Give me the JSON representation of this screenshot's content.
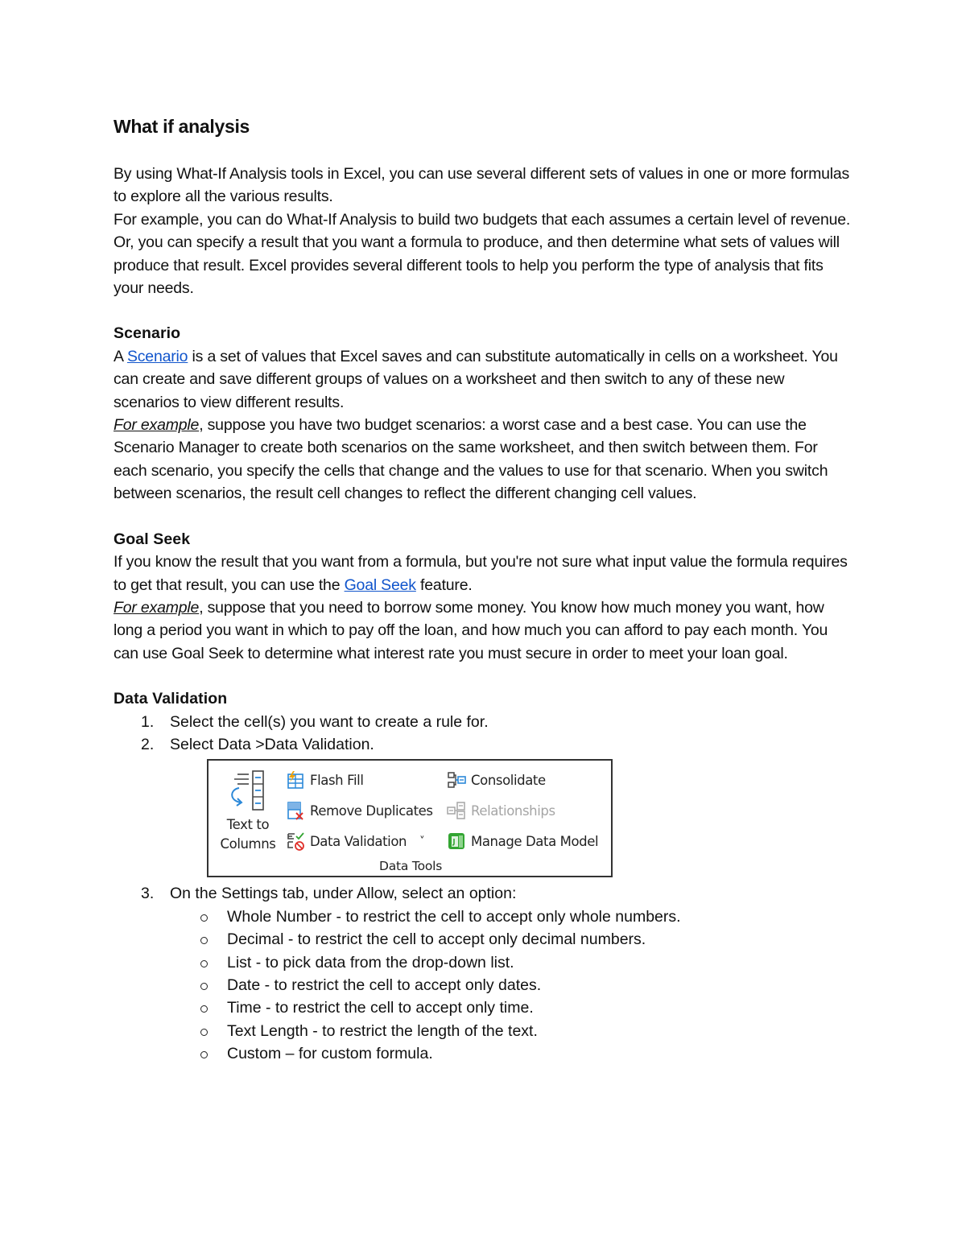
{
  "title": "What if analysis",
  "intro": {
    "p1": "By using What-If Analysis tools in Excel, you can use several different sets of values in one or more formulas to explore all the various results.",
    "p2": "For example, you can do What-If Analysis to build two budgets that each assumes a certain level of revenue. Or, you can specify a result that you want a formula to produce, and then determine what sets of values will produce that result. Excel provides several different tools to help you perform the type of analysis that fits your needs."
  },
  "scenario": {
    "heading": "Scenario",
    "pre_link": "A ",
    "link": "Scenario",
    "post_link": " is a set of values that Excel saves and can substitute automatically in cells on a worksheet. You can create and save different groups of values on a worksheet and then switch to any of these new scenarios to view different results.",
    "example_label": "For example",
    "example_text": ", suppose you have two budget scenarios: a worst case and a best case. You can use the Scenario Manager to create both scenarios on the same worksheet, and then switch between them. For each scenario, you specify the cells that change and the values to use for that scenario. When you switch between scenarios, the result cell changes to reflect the different changing cell values."
  },
  "goal_seek": {
    "heading": "Goal Seek",
    "pre_link": "If you know the result that you want from a formula, but you're not sure what input value the formula requires to get that result, you can use the ",
    "link": "Goal Seek",
    "post_link": " feature.",
    "example_label": "For example",
    "example_text": ", suppose that you need to borrow some money. You know how much money you want, how long a period you want in which to pay off the loan, and how much you can afford to pay each month. You can use Goal Seek to determine what interest rate you must secure in order to meet your loan goal."
  },
  "data_validation": {
    "heading": "Data Validation",
    "steps": [
      {
        "num": "1.",
        "text": "Select the cell(s) you want to create a rule for."
      },
      {
        "num": "2.",
        "text": "Select Data >Data Validation."
      },
      {
        "num": "3.",
        "text": "On the Settings tab, under Allow, select an option:"
      }
    ],
    "options": [
      "Whole Number - to restrict the cell to accept only whole numbers.",
      "Decimal - to restrict the cell to accept only decimal numbers.",
      "List - to pick data from the drop-down list.",
      "Date - to restrict the cell to accept only dates.",
      "Time - to restrict the cell to accept only time.",
      "Text Length - to restrict the length of the text.",
      "Custom – for custom formula."
    ]
  },
  "ribbon": {
    "text_to_columns_line1": "Text to",
    "text_to_columns_line2": "Columns",
    "flash_fill": "Flash Fill",
    "remove_duplicates": "Remove Duplicates",
    "data_validation": "Data Validation",
    "dropdown_arrow": "˅",
    "consolidate": "Consolidate",
    "relationships": "Relationships",
    "manage_data_model": "Manage Data Model",
    "group_label": "Data Tools",
    "colors": {
      "blue": "#2b88d8",
      "red": "#e0302a",
      "green": "#33a532",
      "orange": "#f0a30a",
      "disabled": "#a5a5a5"
    }
  }
}
